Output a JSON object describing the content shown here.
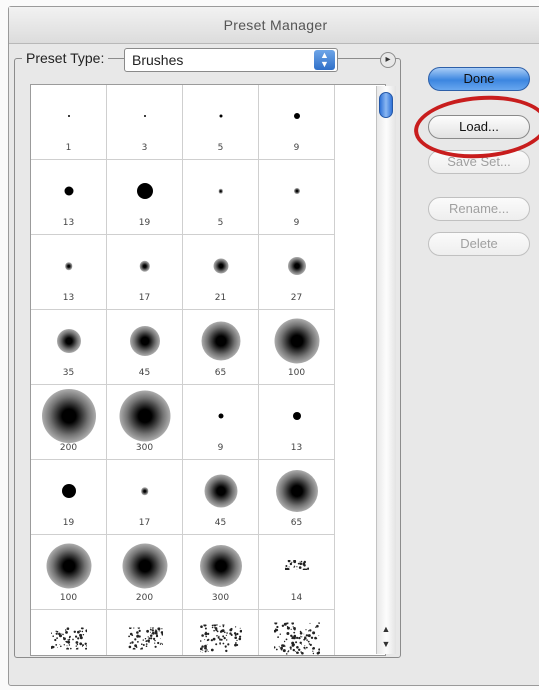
{
  "window": {
    "title": "Preset Manager"
  },
  "preset_type": {
    "label": "Preset Type:",
    "value": "Brushes"
  },
  "buttons": {
    "done": "Done",
    "load": "Load...",
    "save_set": "Save Set...",
    "rename": "Rename...",
    "delete": "Delete"
  },
  "annotation_color": "#c81d1d",
  "brushes": [
    {
      "label": "1",
      "size": 2,
      "soft": false
    },
    {
      "label": "3",
      "size": 2,
      "soft": false
    },
    {
      "label": "5",
      "size": 3,
      "soft": false
    },
    {
      "label": "9",
      "size": 6,
      "soft": false
    },
    {
      "label": "13",
      "size": 9,
      "soft": false
    },
    {
      "label": "19",
      "size": 16,
      "soft": false
    },
    {
      "label": "5",
      "size": 3,
      "soft": true
    },
    {
      "label": "9",
      "size": 4,
      "soft": true
    },
    {
      "label": "13",
      "size": 5,
      "soft": true
    },
    {
      "label": "17",
      "size": 7,
      "soft": true
    },
    {
      "label": "21",
      "size": 10,
      "soft": true
    },
    {
      "label": "27",
      "size": 12,
      "soft": true
    },
    {
      "label": "35",
      "size": 16,
      "soft": true
    },
    {
      "label": "45",
      "size": 20,
      "soft": true
    },
    {
      "label": "65",
      "size": 26,
      "soft": true
    },
    {
      "label": "100",
      "size": 30,
      "soft": true
    },
    {
      "label": "200",
      "size": 36,
      "soft": true
    },
    {
      "label": "300",
      "size": 34,
      "soft": true
    },
    {
      "label": "9",
      "size": 5,
      "soft": false
    },
    {
      "label": "13",
      "size": 8,
      "soft": false
    },
    {
      "label": "19",
      "size": 14,
      "soft": false
    },
    {
      "label": "17",
      "size": 5,
      "soft": true
    },
    {
      "label": "45",
      "size": 22,
      "soft": true
    },
    {
      "label": "65",
      "size": 28,
      "soft": true
    },
    {
      "label": "100",
      "size": 30,
      "soft": true
    },
    {
      "label": "200",
      "size": 30,
      "soft": true
    },
    {
      "label": "300",
      "size": 28,
      "soft": true
    },
    {
      "label": "14",
      "size": 10,
      "soft": false,
      "spray": true
    },
    {
      "label": "",
      "size": 22,
      "soft": false,
      "spray": true
    },
    {
      "label": "",
      "size": 22,
      "soft": false,
      "spray": true
    },
    {
      "label": "",
      "size": 28,
      "soft": false,
      "spray": true
    },
    {
      "label": "",
      "size": 32,
      "soft": false,
      "spray": true
    }
  ]
}
